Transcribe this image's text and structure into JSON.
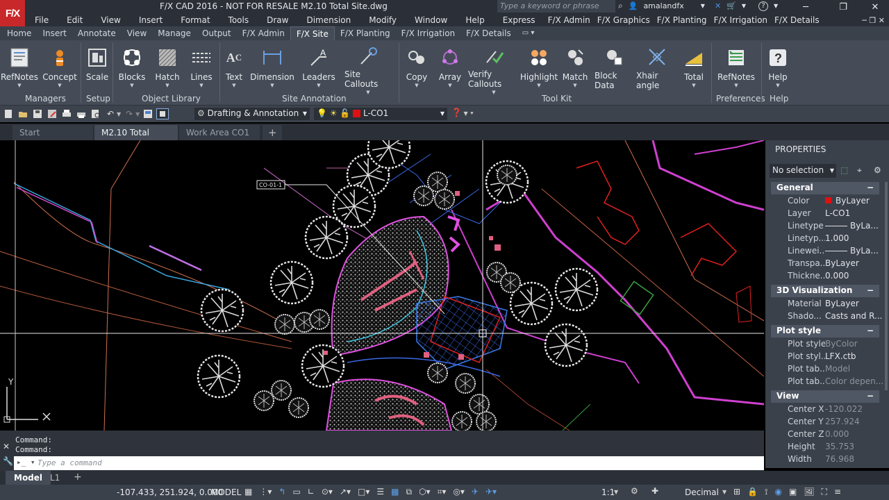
{
  "app": {
    "logo": "F/X",
    "title": "F/X CAD 2016 - NOT FOR RESALE    M2.10 Total Site.dwg",
    "search_placeholder": "Type a keyword or phrase",
    "user": "amalandfx"
  },
  "menu": [
    "File",
    "Edit",
    "View",
    "Insert",
    "Format",
    "Tools",
    "Draw",
    "Dimension",
    "Modify",
    "Window",
    "Help",
    "Express",
    "F/X Admin",
    "F/X Graphics",
    "F/X Planting",
    "F/X Irrigation",
    "F/X Details"
  ],
  "ribbon_tabs": [
    "Home",
    "Insert",
    "Annotate",
    "View",
    "Manage",
    "Output",
    "F/X Admin",
    "F/X Site",
    "F/X Planting",
    "F/X Irrigation",
    "F/X Details"
  ],
  "ribbon_active_tab": "F/X Site",
  "ribbon_buttons": [
    "RefNotes",
    "Concept",
    "Scale",
    "Blocks",
    "Hatch",
    "Lines",
    "Text",
    "Dimension",
    "Leaders",
    "Site Callouts",
    "Copy",
    "Array",
    "Verify Callouts",
    "Highlight",
    "Match",
    "Block Data",
    "Xhair angle",
    "Total",
    "RefNotes",
    "Help"
  ],
  "ribbon_panels": [
    "Managers",
    "Setup",
    "Object Library",
    "Site Annotation",
    "Tool Kit",
    "Preferences",
    "Help"
  ],
  "qat": {
    "workspace": "Drafting & Annotation",
    "layer": "L-CO1"
  },
  "file_tabs": [
    "Start",
    "M2.10 Total Site*",
    "Work Area CO1"
  ],
  "drawing": {
    "callout_label": "CO-01-1",
    "ucs_y": "Y"
  },
  "properties": {
    "header": "PROPERTIES",
    "selection": "No selection",
    "sections": [
      {
        "title": "General",
        "rows": [
          {
            "k": "Color",
            "v": "ByLayer"
          },
          {
            "k": "Layer",
            "v": "L-CO1"
          },
          {
            "k": "Linetype",
            "v": "ByLa..."
          },
          {
            "k": "Linetyp...",
            "v": "1.000"
          },
          {
            "k": "Linewei...",
            "v": "ByLa..."
          },
          {
            "k": "Transpa...",
            "v": "ByLayer"
          },
          {
            "k": "Thickne...",
            "v": "0.000"
          }
        ]
      },
      {
        "title": "3D Visualization",
        "rows": [
          {
            "k": "Material",
            "v": "ByLayer"
          },
          {
            "k": "Shado...",
            "v": "Casts and R..."
          }
        ]
      },
      {
        "title": "Plot style",
        "rows": [
          {
            "k": "Plot style",
            "v": "ByColor"
          },
          {
            "k": "Plot styl...",
            "v": "LFX.ctb"
          },
          {
            "k": "Plot tab...",
            "v": "Model"
          },
          {
            "k": "Plot tab...",
            "v": "Color depen..."
          }
        ]
      },
      {
        "title": "View",
        "rows": [
          {
            "k": "Center X",
            "v": "-120.022"
          },
          {
            "k": "Center Y",
            "v": "257.924"
          },
          {
            "k": "Center Z",
            "v": "0.000"
          },
          {
            "k": "Height",
            "v": "35.753"
          },
          {
            "k": "Width",
            "v": "76.968"
          }
        ]
      }
    ]
  },
  "command": {
    "history": [
      "Command:",
      "Command:"
    ],
    "placeholder": "Type a command"
  },
  "layout_tabs": [
    "Model",
    "L1"
  ],
  "status": {
    "coords": "-107.433, 251.924, 0.000",
    "space": "MODEL",
    "scale": "1:1",
    "units": "Decimal"
  }
}
